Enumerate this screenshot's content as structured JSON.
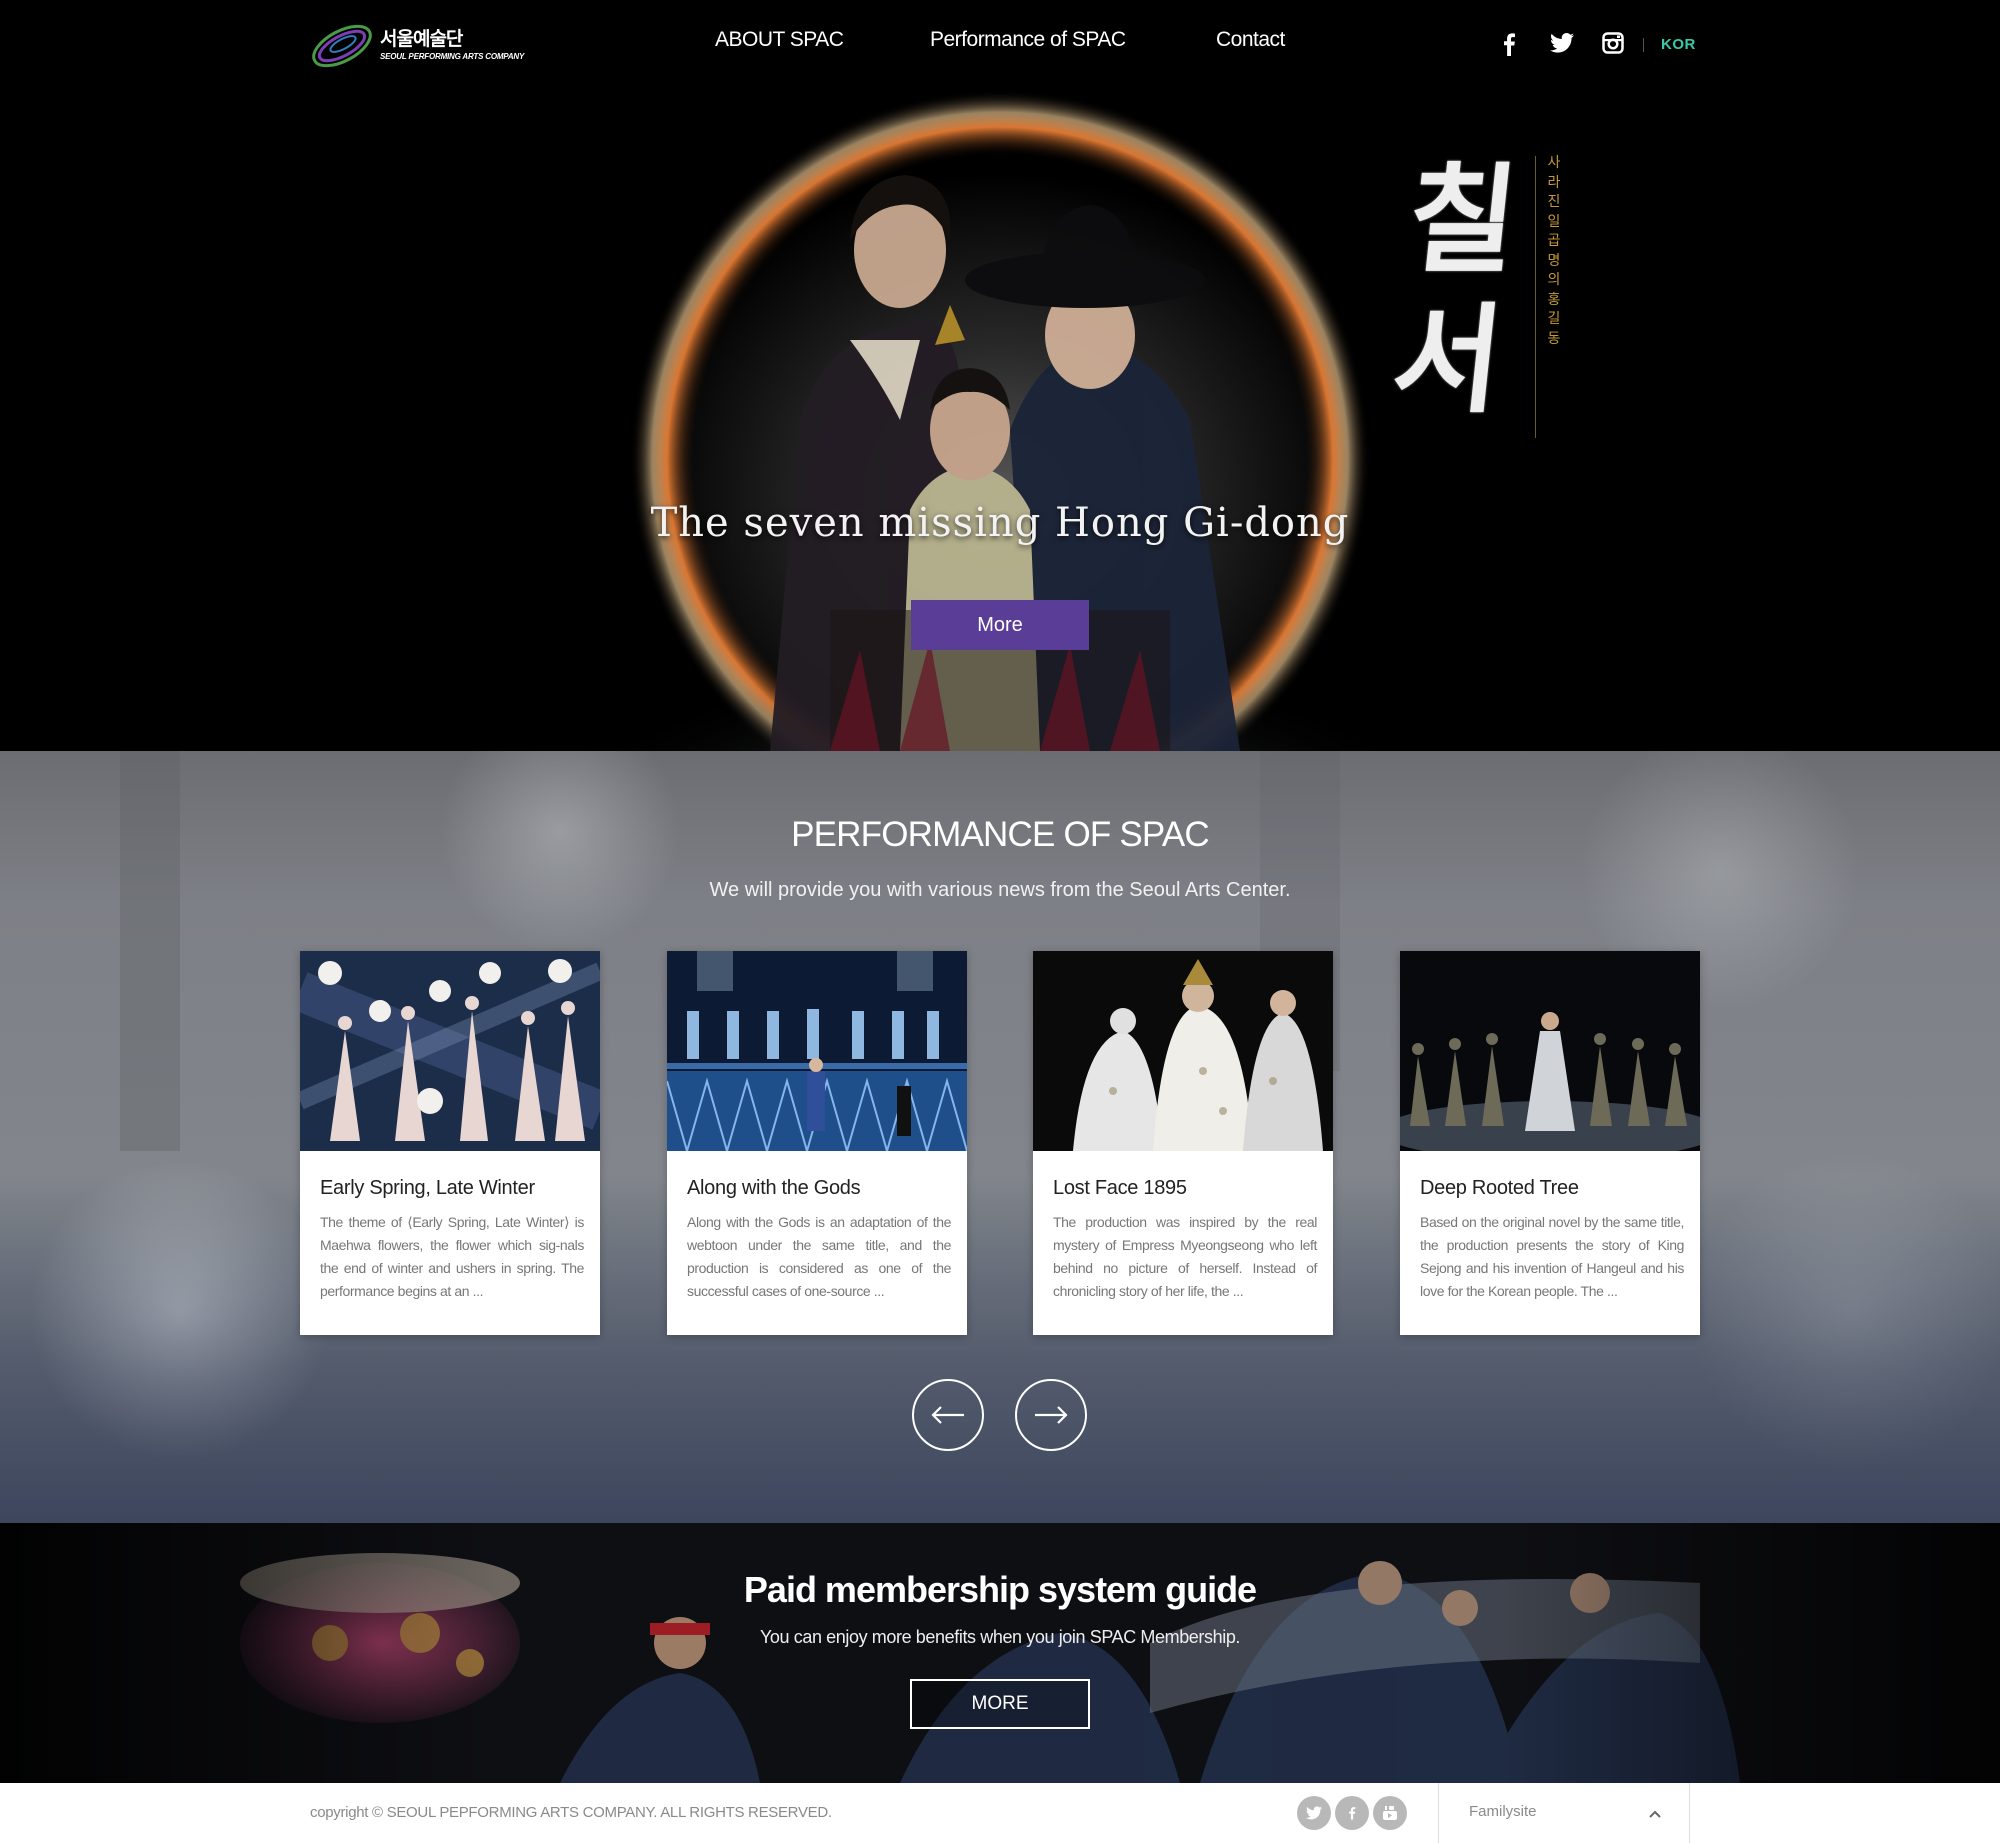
{
  "header": {
    "logo": {
      "korean": "서울예술단",
      "english": "SEOUL PERFORMING ARTS COMPANY"
    },
    "nav": [
      {
        "label": "ABOUT SPAC"
      },
      {
        "label": "Performance of SPAC"
      },
      {
        "label": "Contact"
      }
    ],
    "social_icons": [
      "facebook-icon",
      "twitter-icon",
      "instagram-icon"
    ],
    "language": "KOR",
    "accent_color": "#3cc8a8"
  },
  "hero": {
    "title": "The seven missing Hong Gi-dong",
    "more_label": "More",
    "button_color": "#5a3d97",
    "calligraphy": "칠서",
    "vertical_text": "사라진 일곱 명의 홍길동"
  },
  "performance": {
    "title": "PERFORMANCE OF SPAC",
    "subtitle": "We will provide you with various news from the Seoul Arts Center.",
    "cards": [
      {
        "title": "Early Spring, Late Winter",
        "description": "The theme of ⟨Early Spring, Late Winter⟩ is Maehwa flowers, the flower which sig-nals the end of winter and ushers in spring. The performance begins at an ..."
      },
      {
        "title": "Along with the Gods",
        "description": "Along with the Gods is an adaptation of the webtoon under the same title, and the production is considered as one of the successful cases of one-source ..."
      },
      {
        "title": "Lost Face 1895",
        "description": "The production was inspired by the real mystery of Empress Myeongseong who left behind no picture of herself. Instead of chronicling story of her life, the ..."
      },
      {
        "title": "Deep Rooted Tree",
        "description": "Based on the original novel by the same title, the production presents the story of King Sejong and his invention of Hangeul and his love for the Korean people. The ..."
      }
    ],
    "prev_icon": "arrow-left-icon",
    "next_icon": "arrow-right-icon"
  },
  "membership": {
    "title": "Paid membership system guide",
    "subtitle": "You can enjoy more benefits when you join SPAC Membership.",
    "more_label": "MORE"
  },
  "footer": {
    "copyright": "copyright © SEOUL PEPFORMING ARTS COMPANY. ALL RIGHTS RESERVED.",
    "social_icons": [
      "twitter-icon",
      "facebook-icon",
      "youtube-icon"
    ],
    "familysite_label": "Familysite"
  }
}
